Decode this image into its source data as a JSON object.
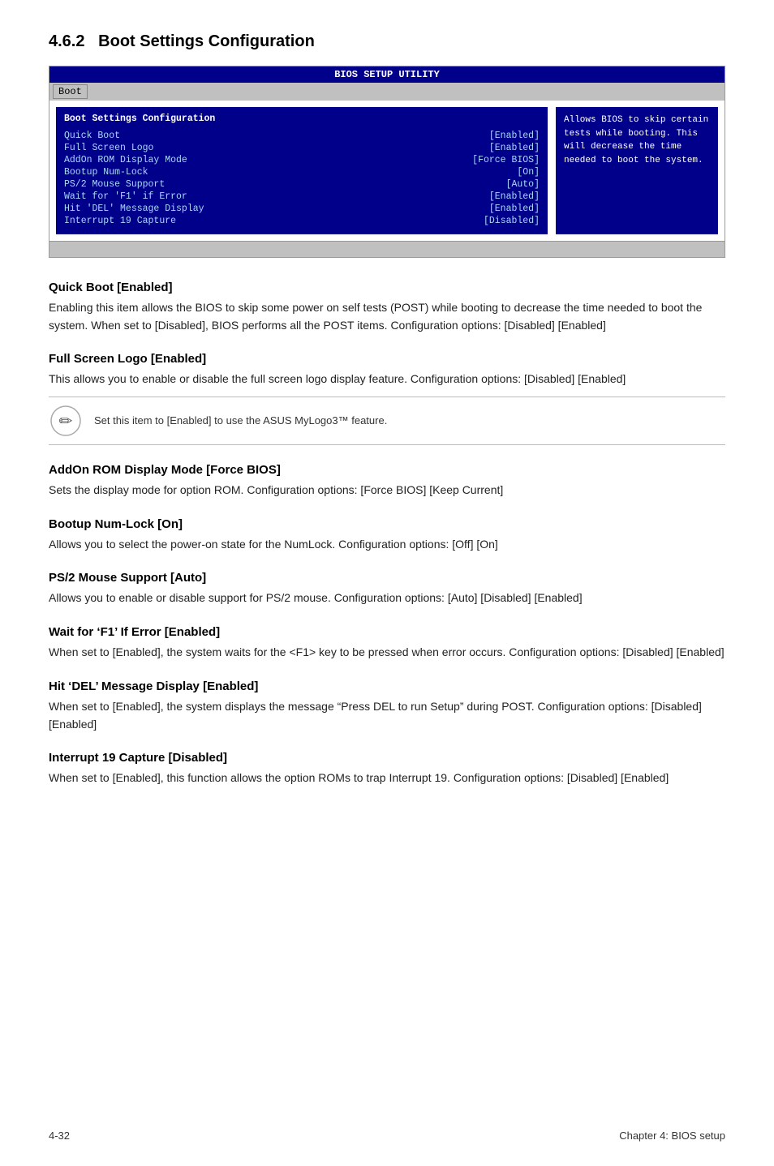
{
  "section": {
    "number": "4.6.2",
    "title": "Boot Settings Configuration"
  },
  "bios": {
    "top_bar": "BIOS SETUP UTILITY",
    "tab": "Boot",
    "left_title": "Boot Settings Configuration",
    "menu_items": [
      {
        "label": "Quick Boot",
        "value": "[Enabled]"
      },
      {
        "label": "Full Screen Logo",
        "value": "[Enabled]"
      },
      {
        "label": "AddOn ROM Display Mode",
        "value": "[Force BIOS]"
      },
      {
        "label": "Bootup Num-Lock",
        "value": "[On]"
      },
      {
        "label": "PS/2 Mouse Support",
        "value": "[Auto]"
      },
      {
        "label": "Wait for 'F1' if Error",
        "value": "[Enabled]"
      },
      {
        "label": "Hit 'DEL' Message Display",
        "value": "[Enabled]"
      },
      {
        "label": "Interrupt 19 Capture",
        "value": "[Disabled]"
      }
    ],
    "right_help": "Allows BIOS to skip certain tests while booting. This will decrease the time needed to boot the system."
  },
  "subsections": [
    {
      "id": "quick-boot",
      "heading": "Quick Boot [Enabled]",
      "text": "Enabling this item allows the BIOS to skip some power on self tests (POST) while booting to decrease the time needed to boot the system. When set to [Disabled], BIOS performs all the POST items. Configuration options: [Disabled] [Enabled]"
    },
    {
      "id": "full-screen-logo",
      "heading": "Full Screen Logo [Enabled]",
      "text": "This allows you to enable or disable the full screen logo display feature. Configuration options: [Disabled] [Enabled]",
      "note": "Set this item to [Enabled] to use the ASUS MyLogo3™ feature."
    },
    {
      "id": "addon-rom",
      "heading": "AddOn ROM Display Mode [Force BIOS]",
      "text": "Sets the display mode for option ROM. Configuration options: [Force BIOS] [Keep Current]"
    },
    {
      "id": "bootup-numlock",
      "heading": "Bootup Num-Lock [On]",
      "text": "Allows you to select the power-on state for the NumLock. Configuration options: [Off] [On]"
    },
    {
      "id": "ps2-mouse",
      "heading": "PS/2 Mouse Support [Auto]",
      "text": "Allows you to enable or disable support for PS/2 mouse. Configuration options: [Auto] [Disabled] [Enabled]"
    },
    {
      "id": "wait-f1",
      "heading": "Wait for ‘F1’ If Error [Enabled]",
      "text": "When set to [Enabled], the system waits for the <F1> key to be pressed when error occurs. Configuration options: [Disabled] [Enabled]"
    },
    {
      "id": "hit-del",
      "heading": "Hit ‘DEL’ Message Display [Enabled]",
      "text": "When set to [Enabled], the system displays the message “Press DEL to run Setup” during POST. Configuration options: [Disabled] [Enabled]"
    },
    {
      "id": "interrupt19",
      "heading": "Interrupt 19 Capture [Disabled]",
      "text": "When set to [Enabled], this function allows the option ROMs to trap Interrupt 19. Configuration options: [Disabled] [Enabled]"
    }
  ],
  "footer": {
    "left": "4-32",
    "right": "Chapter 4: BIOS setup"
  }
}
